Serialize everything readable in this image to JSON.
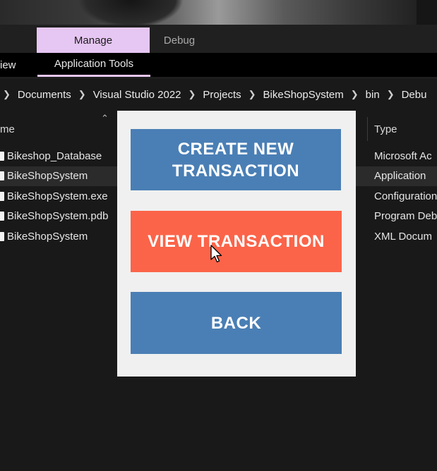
{
  "ribbon": {
    "tabs": [
      {
        "label": "Manage"
      },
      {
        "label": "Debug"
      }
    ],
    "sub_items": [
      {
        "label": "View"
      },
      {
        "label": "Application Tools"
      }
    ],
    "accent_color": "#e6c6f2"
  },
  "address_bar": {
    "crumbs": [
      "Documents",
      "Visual Studio 2022",
      "Projects",
      "BikeShopSystem",
      "bin",
      "Debu"
    ]
  },
  "file_list": {
    "columns": {
      "name": "Name",
      "type": "Type"
    },
    "rows": [
      {
        "name": "Bikeshop_Database",
        "type": "Microsoft Ac",
        "selected": false
      },
      {
        "name": "BikeShopSystem",
        "type": "Application",
        "selected": true
      },
      {
        "name": "BikeShopSystem.exe",
        "type": "Configuration",
        "selected": false
      },
      {
        "name": "BikeShopSystem.pdb",
        "type": "Program Deb",
        "selected": false
      },
      {
        "name": "BikeShopSystem",
        "type": "XML Docum",
        "selected": false
      }
    ]
  },
  "dialog": {
    "create_button": "CREATE NEW TRANSACTION",
    "view_button": "VIEW TRANSACTION",
    "back_button": "BACK",
    "colors": {
      "blue": "#4a7fb5",
      "orange": "#fb6449",
      "background": "#f0f0f0"
    }
  }
}
